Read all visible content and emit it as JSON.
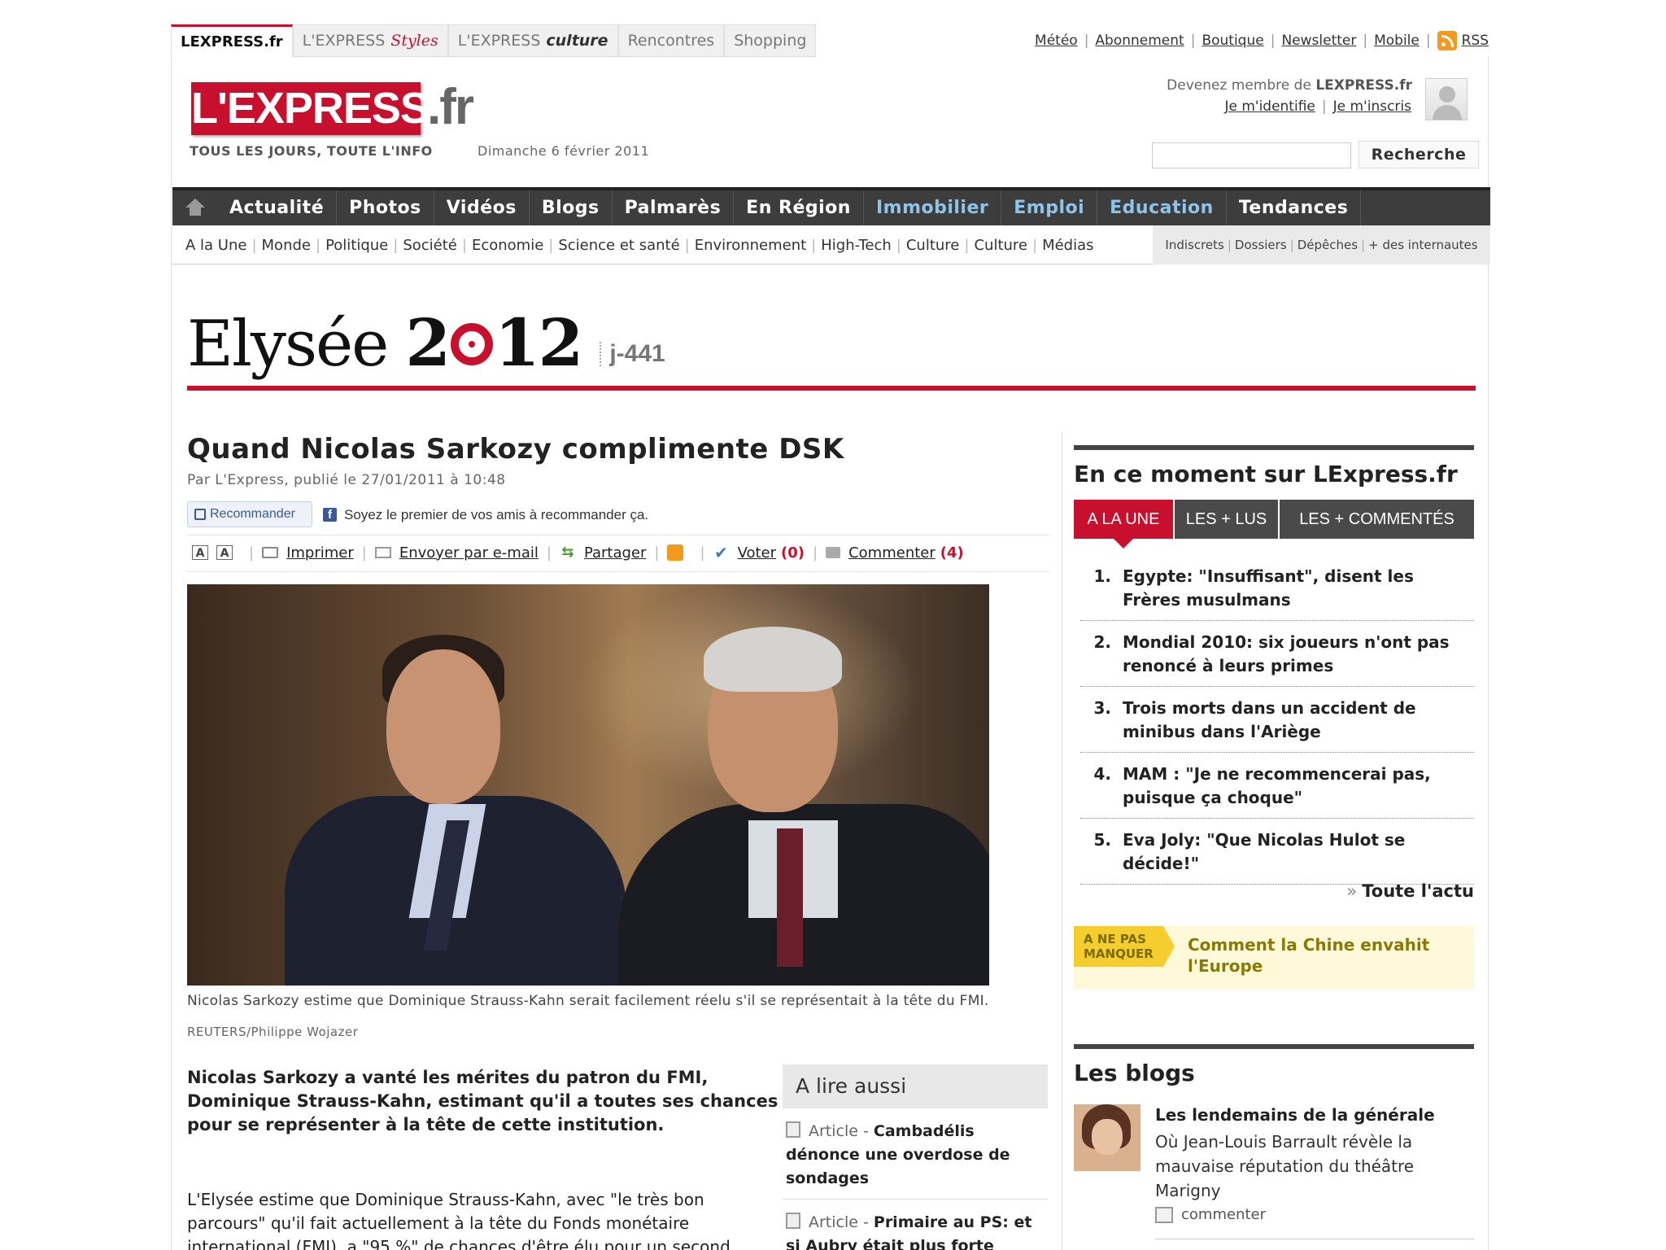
{
  "top": {
    "site_tabs": [
      "LEXPRESS.fr",
      "L'EXPRESS",
      "Styles",
      "L'EXPRESS",
      "culture",
      "Rencontres",
      "Shopping"
    ],
    "links": [
      "Météo",
      "Abonnement",
      "Boutique",
      "Newsletter",
      "Mobile",
      "RSS"
    ]
  },
  "header": {
    "logo": "L'EXPRESS",
    "logo_suffix": ".fr",
    "tagline": "TOUS LES JOURS, TOUTE L'INFO",
    "date": "Dimanche 6 février 2011",
    "member_prefix": "Devenez membre de",
    "member_site": "LEXPRESS.fr",
    "login": "Je m'identifie",
    "signup": "Je m'inscris",
    "search_button": "Recherche",
    "search_placeholder": ""
  },
  "nav": {
    "main": [
      "Actualité",
      "Photos",
      "Vidéos",
      "Blogs",
      "Palmarès",
      "En Région",
      "Immobilier",
      "Emploi",
      "Education",
      "Tendances"
    ],
    "sub": [
      "A la Une",
      "Monde",
      "Politique",
      "Société",
      "Economie",
      "Science et santé",
      "Environnement",
      "High-Tech",
      "Culture",
      "Culture",
      "Médias"
    ],
    "right": [
      "Indiscrets",
      "Dossiers",
      "Dépêches",
      "+ des internautes"
    ]
  },
  "banner": {
    "word": "Elysée",
    "year_a": "2",
    "year_b": "12",
    "countdown": "j-441"
  },
  "article": {
    "title": "Quand Nicolas Sarkozy complimente DSK",
    "byline": "Par L'Express, publié le 27/01/2011 à 10:48",
    "recommend": "Recommander",
    "fb_text": "Soyez le premier de vos amis à recommander ça.",
    "tools": {
      "print": "Imprimer",
      "email": "Envoyer par e-mail",
      "share": "Partager",
      "vote": "Voter",
      "vote_count": "(0)",
      "comment": "Commenter",
      "comment_count": "(4)"
    },
    "caption": "Nicolas Sarkozy estime que Dominique Strauss-Kahn serait facilement réelu s'il se représentait à la tête du FMI.",
    "credit": "REUTERS/Philippe Wojazer",
    "chapo": "Nicolas Sarkozy a vanté les mérites du patron du FMI, Dominique Strauss-Kahn, estimant qu'il a toutes ses chances pour se représenter à la tête de cette institution.",
    "body": "L'Elysée estime que Dominique Strauss-Kahn, avec \"le très bon parcours\" qu'il fait actuellement à la tête du Fonds monétaire international (FMI), a \"95 %\" de chances d'être élu pour un second"
  },
  "lire_aussi": {
    "heading": "A lire aussi",
    "items": [
      {
        "kind": "Article - ",
        "title": "Cambadélis dénonce une overdose de sondages"
      },
      {
        "kind": "Article - ",
        "title": "Primaire au PS: et si Aubry était plus forte"
      }
    ]
  },
  "sidebar": {
    "title": "En ce moment sur LExpress.fr",
    "tabs": [
      "A LA UNE",
      "LES + LUS",
      "LES + COMMENTÉS"
    ],
    "news": [
      {
        "n": "1.",
        "text": "Egypte: \"Insuffisant\", disent les Frères musulmans"
      },
      {
        "n": "2.",
        "text": "Mondial 2010: six joueurs n'ont pas renoncé à leurs primes"
      },
      {
        "n": "3.",
        "text": "Trois morts dans un accident de minibus dans l'Ariège"
      },
      {
        "n": "4.",
        "text": "MAM : \"Je ne recommencerai pas, puisque ça choque\""
      },
      {
        "n": "5.",
        "text": "Eva Joly: \"Que Nicolas Hulot se décide!\""
      }
    ],
    "more": "Toute l'actu",
    "anp_tag": "A NE PAS MANQUER",
    "anp_text": "Comment la Chine envahit l'Europe",
    "blogs_title": "Les blogs",
    "blog_title": "Les lendemains de la générale",
    "blog_desc": "Où Jean-Louis Barrault révèle la mauvaise réputation du théâtre Marigny",
    "blog_comment": "commenter"
  },
  "colors": {
    "brand_red": "#c8102e",
    "nav_dark": "#3d3d3d",
    "nav_blue": "#8fc3e8",
    "facebook": "#3b5998",
    "yellow": "#f5cd2d"
  }
}
